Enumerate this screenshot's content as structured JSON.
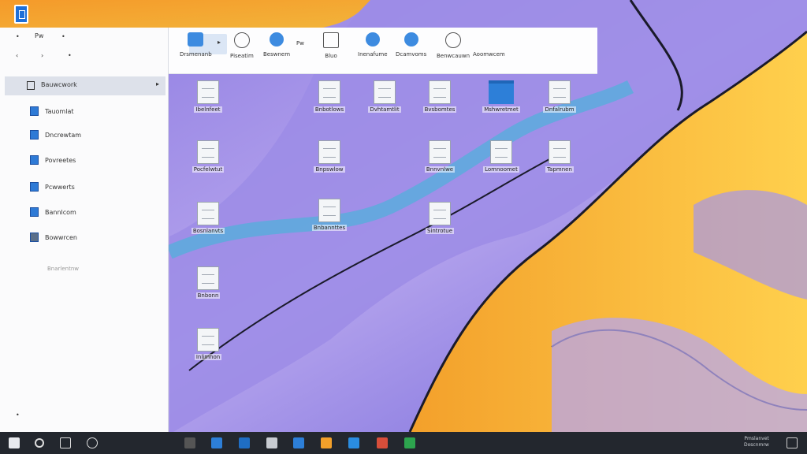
{
  "window": {
    "nav_back": "‹",
    "nav_forward": "›",
    "path_label": "Pw",
    "sidebar": {
      "selected": {
        "label": "Bauwcwork",
        "caret": "▸"
      },
      "items": [
        {
          "label": "Tauomlat"
        },
        {
          "label": "Dncrewtam"
        },
        {
          "label": "Povreetes"
        },
        {
          "label": "Pcwwerts"
        },
        {
          "label": "Bannlcom"
        },
        {
          "label": "Bowwrcen"
        }
      ],
      "dim_label": "Bnarlentnw"
    },
    "ribbon": {
      "buttons": [
        {
          "label": "Drsmenanb",
          "icon": "folder-view-icon"
        },
        {
          "label": "Piseatim",
          "icon": "share-icon"
        },
        {
          "label": "Beswnem",
          "icon": "globe-icon"
        },
        {
          "label": "Pw",
          "icon": "small-text-icon"
        },
        {
          "label": "Bluo",
          "icon": "person-icon"
        },
        {
          "label": "Inenafume",
          "icon": "user-icon"
        },
        {
          "label": "Dcamvoms",
          "icon": "network-icon"
        },
        {
          "label": "Benwcauwn",
          "icon": "settings-icon"
        },
        {
          "label": "Aoomwcem",
          "icon": "document-icon"
        }
      ]
    }
  },
  "desktop": {
    "files": [
      {
        "name": "Ibelnfeet",
        "type": "doc"
      },
      {
        "name": "Bnbotlows",
        "type": "doc"
      },
      {
        "name": "Dvhtamtlit",
        "type": "doc"
      },
      {
        "name": "Bvsbomtes",
        "type": "doc"
      },
      {
        "name": "Mshwretmet",
        "type": "folder"
      },
      {
        "name": "Dnfalrubm",
        "type": "doc"
      },
      {
        "name": "Pocfelwtut",
        "type": "doc"
      },
      {
        "name": "Bnpswlow",
        "type": "doc"
      },
      {
        "name": "Bnnvnlwe",
        "type": "doc"
      },
      {
        "name": "Lomnoomet",
        "type": "doc"
      },
      {
        "name": "Tapmnen",
        "type": "doc"
      },
      {
        "name": "Bosnlanvts",
        "type": "doc"
      },
      {
        "name": "Bnbannttes",
        "type": "doc"
      },
      {
        "name": "Sintrotue",
        "type": "doc"
      },
      {
        "name": "Bnbonn",
        "type": "doc"
      },
      {
        "name": "Inlimnon",
        "type": "doc"
      }
    ]
  },
  "taskbar": {
    "tray_line1": "Pmslanvet",
    "tray_line2": "Doscnmrw",
    "accent": "#2d7fd8",
    "background": "#23272e"
  }
}
